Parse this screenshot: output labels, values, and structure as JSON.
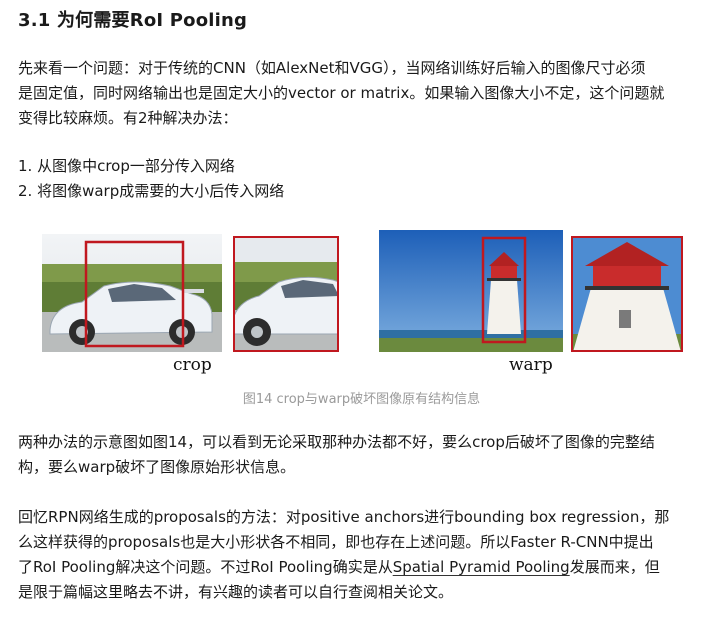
{
  "heading": "3.1 为何需要RoI Pooling",
  "intro": {
    "lines": [
      "先来看一个问题：对于传统的CNN（如AlexNet和VGG），当网络训练好后输入的图像尺寸必须",
      "是固定值，同时网络输出也是固定大小的vector or matrix。如果输入图像大小不定，这个问题就",
      "变得比较麻烦。有2种解决办法："
    ]
  },
  "list": {
    "items": [
      "1. 从图像中crop一部分传入网络",
      "2. 将图像warp成需要的大小后传入网络"
    ]
  },
  "figure": {
    "crop_label": "crop",
    "warp_label": "warp",
    "caption": "图14 crop与warp破坏图像原有结构信息",
    "box_color": "#c0181f"
  },
  "para2": {
    "lines": [
      "两种办法的示意图如图14，可以看到无论采取那种办法都不好，要么crop后破坏了图像的完整结",
      "构，要么warp破坏了图像原始形状信息。"
    ]
  },
  "para3": {
    "line1": "回忆RPN网络生成的proposals的方法：对positive anchors进行bounding box regression，那",
    "line2": "么这样获得的proposals也是大小形状各不相同，即也存在上述问题。所以Faster R-CNN中提出",
    "line3_before": "了RoI Pooling解决这个问题。不过RoI Pooling确实是从",
    "line3_link": "Spatial Pyramid Pooling",
    "line3_after": "发展而来，但",
    "line4": "是限于篇幅这里略去不讲，有兴趣的读者可以自行查阅相关论文。"
  }
}
